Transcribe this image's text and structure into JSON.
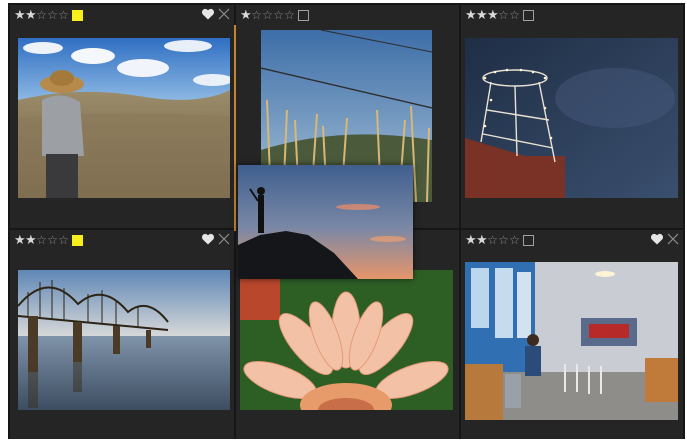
{
  "colors": {
    "grid_bg": "#161616",
    "cell_bg": "#252525",
    "star_on": "#d8d8d8",
    "star_off": "#8a8a8a",
    "color_label_yellow": "#f6ef1c",
    "drag_accent": "#c8832e"
  },
  "cells": [
    {
      "id": "hiker",
      "rating": 2,
      "color_label": "yellow",
      "flag": "heart-and-reject",
      "photo": "hiker in brimmed hat in grassland under blue sky"
    },
    {
      "id": "wire-grass",
      "rating": 1,
      "color_label": "none",
      "flag": "none",
      "photo": "tall grass and wire against evening sky"
    },
    {
      "id": "tower",
      "rating": 3,
      "color_label": "none",
      "flag": "none",
      "photo": "lit metal tower on brick building at dusk"
    },
    {
      "id": "bridge",
      "rating": 2,
      "color_label": "yellow",
      "flag": "heart-and-reject",
      "photo": "truss bridge over calm river"
    },
    {
      "id": "flower",
      "rating": 2,
      "color_label": "none",
      "flag": "none",
      "photo": "close-up of peach gerbera flower"
    },
    {
      "id": "cafe",
      "rating": 2,
      "color_label": "none",
      "flag": "heart-and-reject",
      "photo": "cafe interior with person at counter"
    }
  ],
  "dragging": {
    "photo": "silhouette on cliff at sunset"
  },
  "icons": {
    "star": "star-icon",
    "heart": "heart-icon",
    "reject": "reject-x-icon",
    "color_label": "color-label-icon"
  }
}
